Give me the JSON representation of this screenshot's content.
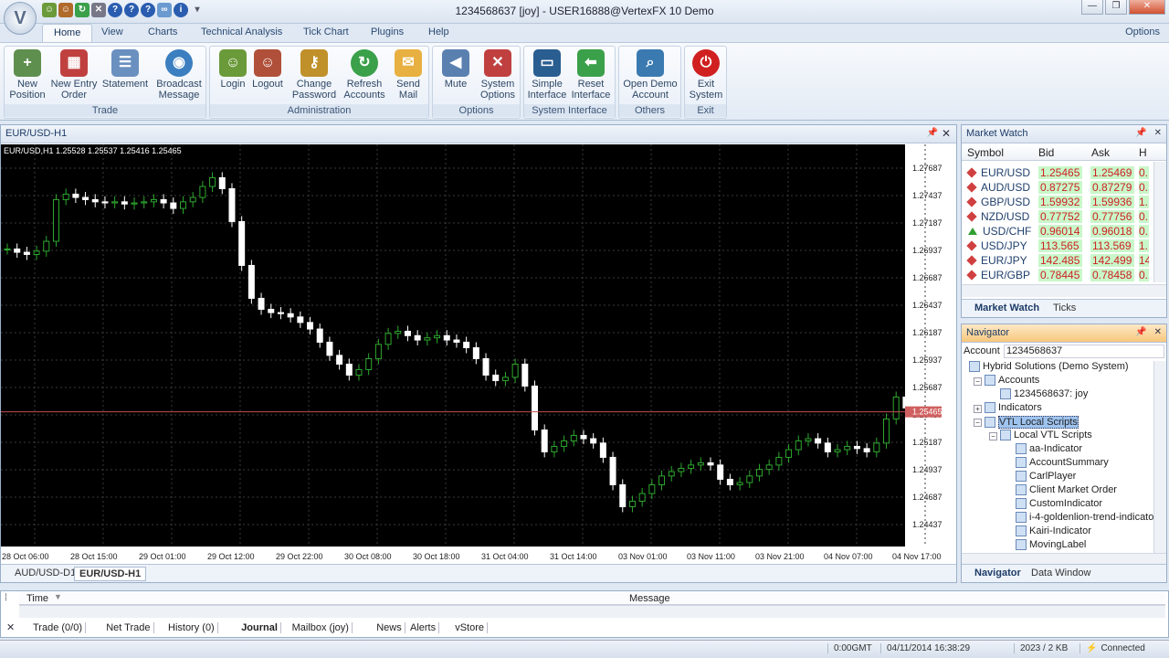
{
  "window": {
    "title": "1234568637 [joy] - USER16888@VertexFX 10 Demo"
  },
  "ribbon_tabs": [
    {
      "label": "Home"
    },
    {
      "label": "View"
    },
    {
      "label": "Charts"
    },
    {
      "label": "Technical Analysis"
    },
    {
      "label": "Tick Chart"
    },
    {
      "label": "Plugins"
    },
    {
      "label": "Help"
    }
  ],
  "ribbon_options": "Options",
  "groups": {
    "trade": "Trade",
    "administration": "Administration",
    "options": "Options",
    "system_interface": "System Interface",
    "others": "Others",
    "exit": "Exit"
  },
  "buttons": {
    "new_position": [
      "New",
      "Position"
    ],
    "new_entry_order": [
      "New Entry",
      "Order"
    ],
    "statement": [
      "Statement",
      ""
    ],
    "broadcast": [
      "Broadcast",
      "Message"
    ],
    "login": [
      "Login",
      ""
    ],
    "logout": [
      "Logout",
      ""
    ],
    "change_password": [
      "Change",
      "Password"
    ],
    "refresh_accounts": [
      "Refresh",
      "Accounts"
    ],
    "send_mail": [
      "Send",
      "Mail"
    ],
    "mute": [
      "Mute",
      ""
    ],
    "system_options": [
      "System",
      "Options"
    ],
    "simple_interface": [
      "Simple",
      "Interface"
    ],
    "reset_interface": [
      "Reset",
      "Interface"
    ],
    "open_demo": [
      "Open Demo",
      "Account"
    ],
    "exit_system": [
      "Exit",
      "System"
    ]
  },
  "chart": {
    "window_title": "EUR/USD-H1",
    "ohlc_label": "EUR/USD,H1  1.25528  1.25537  1.25416  1.25465",
    "current_price": "1.25465",
    "y_ticks": [
      "1.27687",
      "1.27437",
      "1.27187",
      "1.26937",
      "1.26687",
      "1.26437",
      "1.26187",
      "1.25937",
      "1.25687",
      "1.25437",
      "1.25187",
      "1.24937",
      "1.24687",
      "1.24437"
    ],
    "x_ticks": [
      "28 Oct 06:00",
      "28 Oct 15:00",
      "29 Oct 01:00",
      "29 Oct 12:00",
      "29 Oct 22:00",
      "30 Oct 08:00",
      "30 Oct 18:00",
      "31 Oct 04:00",
      "31 Oct 14:00",
      "03 Nov 01:00",
      "03 Nov 11:00",
      "03 Nov 21:00",
      "04 Nov 07:00",
      "04 Nov 17:00"
    ],
    "tabs": [
      {
        "label": "AUD/USD-D1"
      },
      {
        "label": "EUR/USD-H1"
      }
    ]
  },
  "market_watch": {
    "title": "Market Watch",
    "columns": {
      "symbol": "Symbol",
      "bid": "Bid",
      "ask": "Ask",
      "h": "H"
    },
    "rows": [
      {
        "symbol": "EUR/USD",
        "bid": "1.25465",
        "ask": "1.25469",
        "h": "0.",
        "dir": "down"
      },
      {
        "symbol": "AUD/USD",
        "bid": "0.87275",
        "ask": "0.87279",
        "h": "0.",
        "dir": "down"
      },
      {
        "symbol": "GBP/USD",
        "bid": "1.59932",
        "ask": "1.59936",
        "h": "1.",
        "dir": "down"
      },
      {
        "symbol": "NZD/USD",
        "bid": "0.77752",
        "ask": "0.77756",
        "h": "0.",
        "dir": "down"
      },
      {
        "symbol": "USD/CHF",
        "bid": "0.96014",
        "ask": "0.96018",
        "h": "0.",
        "dir": "up"
      },
      {
        "symbol": "USD/JPY",
        "bid": "113.565",
        "ask": "113.569",
        "h": "1.",
        "dir": "down"
      },
      {
        "symbol": "EUR/JPY",
        "bid": "142.485",
        "ask": "142.499",
        "h": "14",
        "dir": "down"
      },
      {
        "symbol": "EUR/GBP",
        "bid": "0.78445",
        "ask": "0.78458",
        "h": "0.",
        "dir": "down"
      }
    ],
    "tabs": {
      "market_watch": "Market Watch",
      "ticks": "Ticks"
    }
  },
  "navigator": {
    "title": "Navigator",
    "account_label": "Account",
    "account_value": "1234568637",
    "tree": [
      "Hybrid Solutions (Demo System)",
      "Accounts",
      "1234568637: joy",
      "Indicators",
      "VTL Local Scripts",
      "Local VTL Scripts",
      "aa-Indicator",
      "AccountSummary",
      "CarlPlayer",
      "Client Market Order",
      "CustomIndicator",
      "i-4-goldenlion-trend-indicator",
      "Kairi-Indicator",
      "MovingLabel"
    ],
    "tabs": {
      "navigator": "Navigator",
      "data_window": "Data Window"
    }
  },
  "terminal": {
    "col_time": "Time",
    "col_message": "Message",
    "tabs": [
      "Trade (0/0)",
      "Net Trade",
      "History (0)",
      "Journal",
      "Mailbox (joy)",
      "News",
      "Alerts",
      "vStore"
    ]
  },
  "status": {
    "gmt": "0:00GMT",
    "datetime": "04/11/2014 16:38:29",
    "traffic": "2023 / 2 KB",
    "connection": "Connected"
  },
  "colors": {
    "bull": "#2ea82e",
    "bear": "#ffffff",
    "grid": "#3a3a3a",
    "price_line": "#c05050"
  }
}
